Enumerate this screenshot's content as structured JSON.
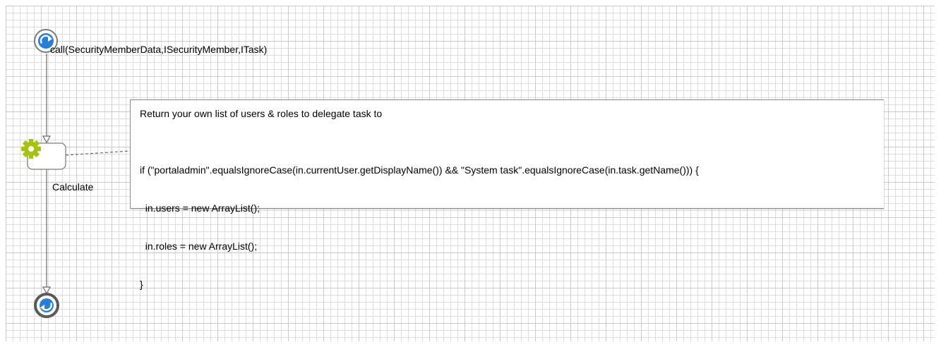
{
  "process": {
    "start_event_label": "call(SecurityMemberData,ISecurityMember,ITask)",
    "script_step_label": "Calculate"
  },
  "annotation": {
    "title": "Return your own list of users & roles to delegate task to",
    "code_lines": [
      "if (\"portaladmin\".equalsIgnoreCase(in.currentUser.getDisplayName()) && \"System task\".equalsIgnoreCase(in.task.getName())) {",
      "  in.users = new ArrayList();",
      "  in.roles = new ArrayList();",
      "}"
    ]
  },
  "icons": {
    "start": "call-start-icon",
    "step": "gear-icon",
    "end": "call-end-icon"
  },
  "colors": {
    "event_blue": "#2a7fd4",
    "gear_green": "#a6c20f",
    "event_ring": "#5a5a5a"
  }
}
